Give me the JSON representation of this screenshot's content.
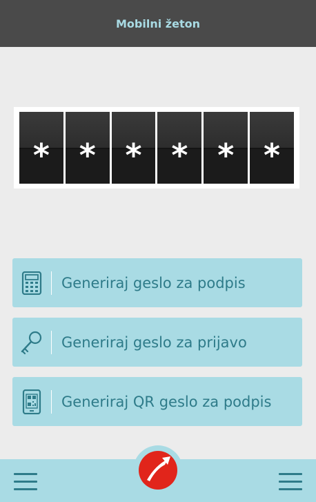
{
  "header": {
    "title": "Mobilni žeton"
  },
  "token": {
    "digits": [
      "*",
      "*",
      "*",
      "*",
      "*",
      "*"
    ]
  },
  "actions": [
    {
      "label": "Generiraj geslo za podpis",
      "icon": "calculator-icon"
    },
    {
      "label": "Generiraj geslo za prijavo",
      "icon": "key-icon"
    },
    {
      "label": "Generiraj QR geslo za podpis",
      "icon": "qr-phone-icon"
    }
  ],
  "bottom_bar": {
    "left_icon": "menu-icon",
    "center_icon": "unicredit-logo",
    "right_icon": "menu-icon"
  },
  "colors": {
    "header_bg": "#4a4a4a",
    "header_text": "#a9dbe4",
    "accent_bg": "#a9dbe4",
    "accent_text": "#2e7b89",
    "logo_red": "#e1251b"
  }
}
